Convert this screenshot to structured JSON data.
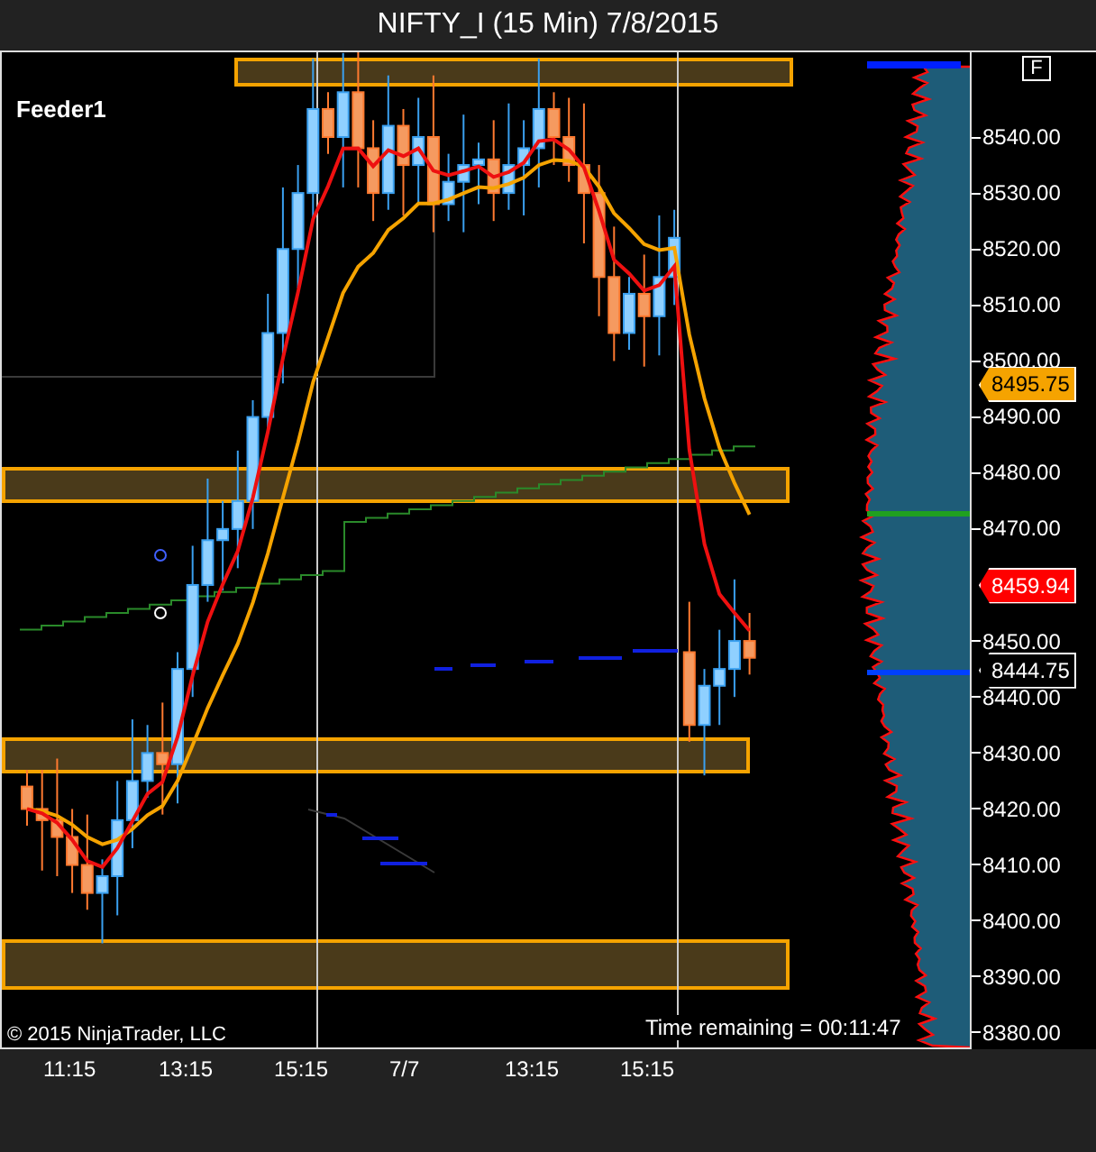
{
  "window": {
    "title": "NIFTY_I (15 Min)  7/8/2015"
  },
  "chart": {
    "label": "Feeder1",
    "copyright": "© 2015 NinjaTrader, LLC",
    "time_remaining": "Time remaining = 00:11:47",
    "button": "F"
  },
  "price_axis": [
    "8540.00",
    "8530.00",
    "8520.00",
    "8510.00",
    "8500.00",
    "8490.00",
    "8480.00",
    "8470.00",
    "8450.00",
    "8440.00",
    "8430.00",
    "8420.00",
    "8410.00",
    "8400.00",
    "8390.00",
    "8380.00"
  ],
  "price_tags": [
    {
      "text": "8495.75",
      "color": "#f5a300"
    },
    {
      "text": "8459.94",
      "color": "#ff0000"
    },
    {
      "text": "8444.75",
      "color": "#000000"
    }
  ],
  "time_axis": [
    "11:15",
    "13:15",
    "15:15",
    "7/7",
    "13:15",
    "15:15"
  ]
}
